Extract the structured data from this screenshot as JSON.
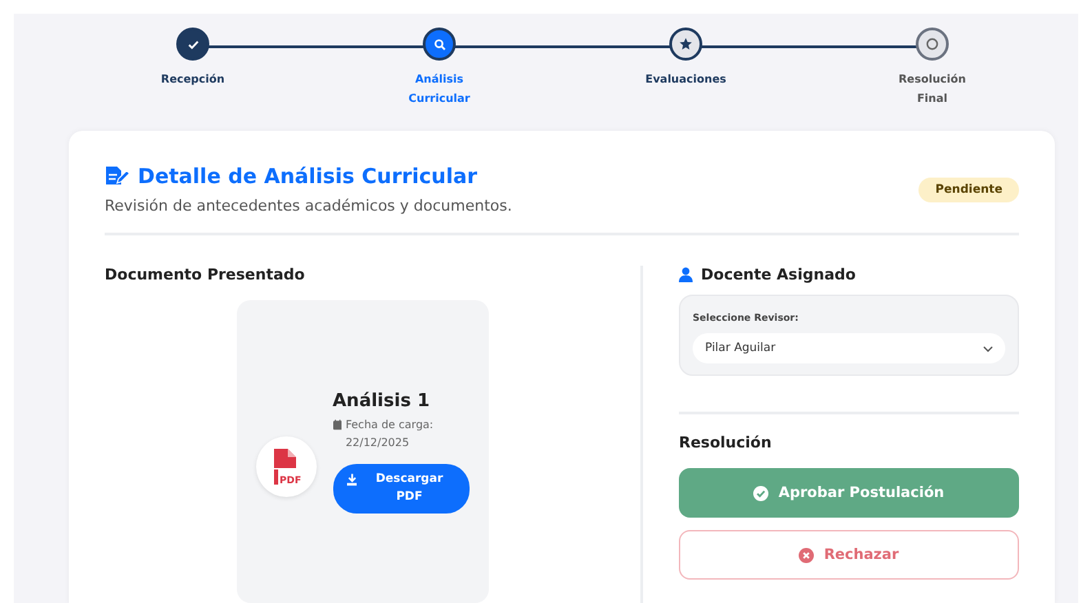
{
  "stepper": [
    {
      "label": "Recepción",
      "kind": "done",
      "selected": false
    },
    {
      "label": "Análisis Curricular",
      "kind": "current",
      "selected": true
    },
    {
      "label": "Evaluaciones",
      "kind": "next",
      "selected": false
    },
    {
      "label": "Resolución Final",
      "kind": "pending",
      "selected": false
    }
  ],
  "detail": {
    "title": "Detalle de Análisis Curricular",
    "subtitle": "Revisión de antecedentes académicos y documentos.",
    "status_badge": "Pendiente",
    "document_section": {
      "heading": "Documento Presentado",
      "document": {
        "name": "Análisis 1",
        "date_label": "Fecha de carga:",
        "date": "22/12/2025",
        "file_type": "PDF",
        "download_button": "Descargar PDF"
      }
    },
    "reviewer_section": {
      "heading": "Docente Asignado",
      "select_label": "Seleccione Revisor:",
      "select_value": "Pilar Aguilar"
    },
    "resolution_section": {
      "heading": "Resolución",
      "approve_button": "Aprobar Postulación",
      "reject_button": "Rechazar"
    }
  }
}
